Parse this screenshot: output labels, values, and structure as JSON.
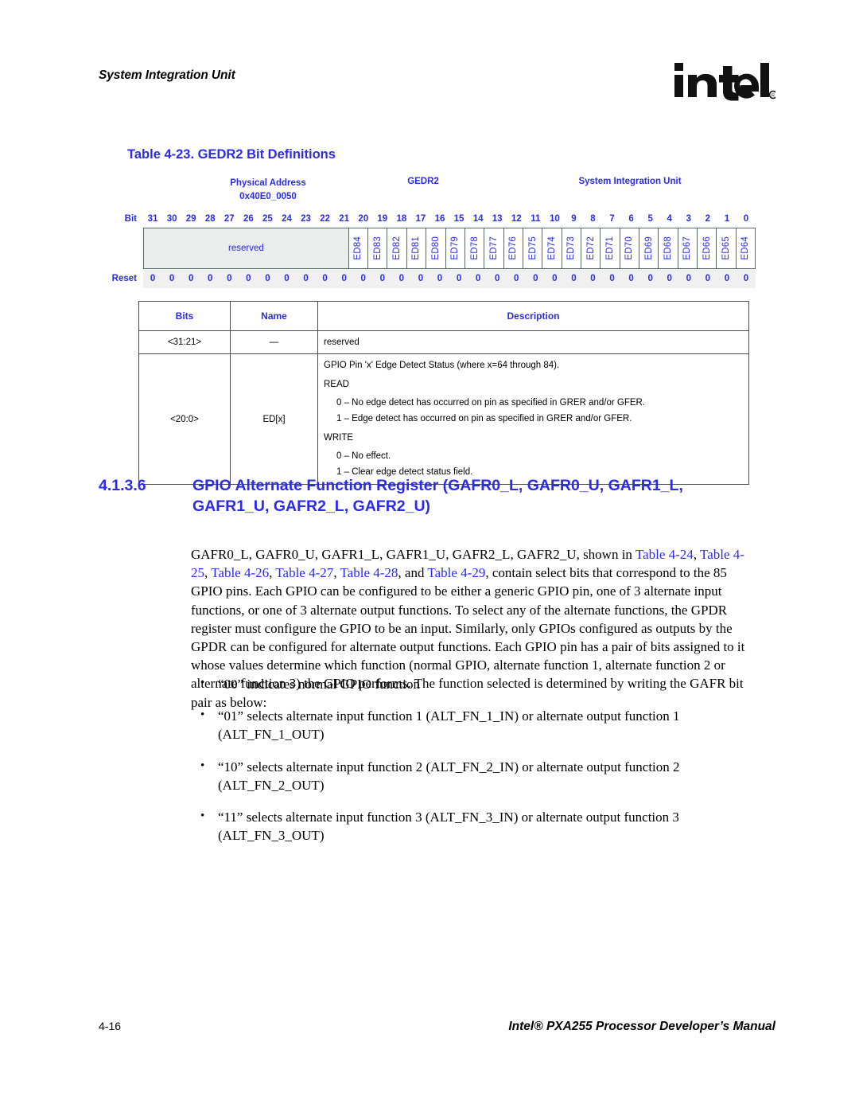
{
  "header": {
    "running_head": "System Integration Unit",
    "logo_name": "intel-logo",
    "logo_text": "intel",
    "logo_mark": "®"
  },
  "table_caption": "Table 4-23. GEDR2 Bit Definitions",
  "register_diagram": {
    "physical_address_label": "Physical Address",
    "physical_address_value": "0x40E0_0050",
    "register_name": "GEDR2",
    "unit_name": "System Integration Unit",
    "bit_row_label": "Bit",
    "reset_row_label": "Reset",
    "bit_numbers": [
      "31",
      "30",
      "29",
      "28",
      "27",
      "26",
      "25",
      "24",
      "23",
      "22",
      "21",
      "20",
      "19",
      "18",
      "17",
      "16",
      "15",
      "14",
      "13",
      "12",
      "11",
      "10",
      "9",
      "8",
      "7",
      "6",
      "5",
      "4",
      "3",
      "2",
      "1",
      "0"
    ],
    "reserved_label": "reserved",
    "reserved_span": 11,
    "field_names": [
      "ED84",
      "ED83",
      "ED82",
      "ED81",
      "ED80",
      "ED79",
      "ED78",
      "ED77",
      "ED76",
      "ED75",
      "ED74",
      "ED73",
      "ED72",
      "ED71",
      "ED70",
      "ED69",
      "ED68",
      "ED67",
      "ED66",
      "ED65",
      "ED64"
    ],
    "reset_values": [
      "0",
      "0",
      "0",
      "0",
      "0",
      "0",
      "0",
      "0",
      "0",
      "0",
      "0",
      "0",
      "0",
      "0",
      "0",
      "0",
      "0",
      "0",
      "0",
      "0",
      "0",
      "0",
      "0",
      "0",
      "0",
      "0",
      "0",
      "0",
      "0",
      "0",
      "0",
      "0"
    ]
  },
  "bit_definitions": {
    "columns": [
      "Bits",
      "Name",
      "Description"
    ],
    "rows": [
      {
        "bits": "<31:21>",
        "name": "—",
        "description_lines": [
          {
            "text": "reserved",
            "indent": false,
            "gap": false
          }
        ]
      },
      {
        "bits": "<20:0>",
        "name": "ED[x]",
        "description_lines": [
          {
            "text": "GPIO Pin 'x' Edge Detect Status (where x=64 through 84).",
            "indent": false,
            "gap": false
          },
          {
            "text": "READ",
            "indent": false,
            "gap": false
          },
          {
            "text": "0 – No edge detect has occurred on pin as specified in GRER and/or GFER.",
            "indent": true,
            "gap": false
          },
          {
            "text": "1 – Edge detect has occurred on pin as specified in GRER and/or GFER.",
            "indent": true,
            "gap": false
          },
          {
            "text": "WRITE",
            "indent": false,
            "gap": true
          },
          {
            "text": "0 – No effect.",
            "indent": true,
            "gap": false
          },
          {
            "text": "1 – Clear edge detect status field.",
            "indent": true,
            "gap": false
          }
        ]
      }
    ]
  },
  "section": {
    "number": "4.1.3.6",
    "title": "GPIO Alternate Function Register (GAFR0_L, GAFR0_U, GAFR1_L, GAFR1_U, GAFR2_L, GAFR2_U)"
  },
  "body": {
    "lead_in": "GAFR0_L, GAFR0_U, GAFR1_L, GAFR1_U, GAFR2_L, GAFR2_U, shown in ",
    "xref_1": "Table 4-24",
    "sep_1": ", ",
    "xref_2": "Table 4-25",
    "sep_2": ", ",
    "xref_3": "Table 4-26",
    "sep_3": ", ",
    "xref_4": "Table 4-27",
    "sep_4": ", ",
    "xref_5": "Table 4-28",
    "sep_5": ", and ",
    "xref_6": "Table 4-29",
    "tail": ", contain select bits that correspond to the 85 GPIO pins. Each GPIO can be configured to be either a generic GPIO pin, one of 3 alternate input functions, or one of 3 alternate output functions. To select any of the alternate functions, the GPDR register must configure the GPIO to be an input. Similarly, only GPIOs configured as outputs by the GPDR can be configured for alternate output functions. Each GPIO pin has a pair of bits assigned to it whose values determine which function (normal GPIO, alternate function 1, alternate function 2 or alternate function 3) the GPIO performs. The function selected is determined by writing the GAFR bit pair as below:"
  },
  "bullets": [
    "“00” indicates normal GPIO function",
    "“01” selects alternate input function 1 (ALT_FN_1_IN) or alternate output function 1 (ALT_FN_1_OUT)",
    "“10” selects alternate input function 2 (ALT_FN_2_IN) or alternate output function 2 (ALT_FN_2_OUT)",
    "“11” selects alternate input function 3 (ALT_FN_3_IN) or alternate output function 3 (ALT_FN_3_OUT)"
  ],
  "footer": {
    "page_number": "4-16",
    "manual_title": "Intel® PXA255 Processor Developer’s Manual"
  },
  "colors": {
    "accent_blue": "#2B2BEE",
    "cell_fill": "#e9edec",
    "cell_border": "#5a6b66",
    "table_border": "#4d4d4d"
  }
}
